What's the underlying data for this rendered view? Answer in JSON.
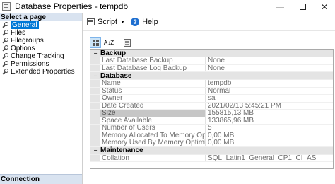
{
  "window": {
    "title": "Database Properties - tempdb",
    "minimize": "—",
    "close": "✕"
  },
  "sidebar": {
    "header": "Select a page",
    "items": [
      {
        "label": "General",
        "selected": true
      },
      {
        "label": "Files",
        "selected": false
      },
      {
        "label": "Filegroups",
        "selected": false
      },
      {
        "label": "Options",
        "selected": false
      },
      {
        "label": "Change Tracking",
        "selected": false
      },
      {
        "label": "Permissions",
        "selected": false
      },
      {
        "label": "Extended Properties",
        "selected": false
      }
    ],
    "footer": "Connection"
  },
  "toolbar": {
    "script_label": "Script",
    "help_label": "Help",
    "help_icon_text": "?",
    "dropdown_arrow": "▼"
  },
  "property_grid": {
    "toolbar": {
      "alpha_sort_text": "A↓Z"
    },
    "categories": [
      {
        "name": "Backup",
        "toggle": "−",
        "rows": [
          {
            "name": "Last Database Backup",
            "value": "None"
          },
          {
            "name": "Last Database Log Backup",
            "value": "None"
          }
        ]
      },
      {
        "name": "Database",
        "toggle": "−",
        "rows": [
          {
            "name": "Name",
            "value": "tempdb"
          },
          {
            "name": "Status",
            "value": "Normal"
          },
          {
            "name": "Owner",
            "value": "sa"
          },
          {
            "name": "Date Created",
            "value": "2021/02/13 5:45:21 PM"
          },
          {
            "name": "Size",
            "value": "155815,13 MB",
            "selected": true
          },
          {
            "name": "Space Available",
            "value": "133865,96 MB"
          },
          {
            "name": "Number of Users",
            "value": "5"
          },
          {
            "name": "Memory Allocated To Memory Optimized Objects",
            "value": "0,00 MB"
          },
          {
            "name": "Memory Used By Memory Optimized Objects",
            "value": "0,00 MB"
          }
        ]
      },
      {
        "name": "Maintenance",
        "toggle": "−",
        "rows": [
          {
            "name": "Collation",
            "value": "SQL_Latin1_General_CP1_CI_AS"
          }
        ]
      }
    ]
  }
}
